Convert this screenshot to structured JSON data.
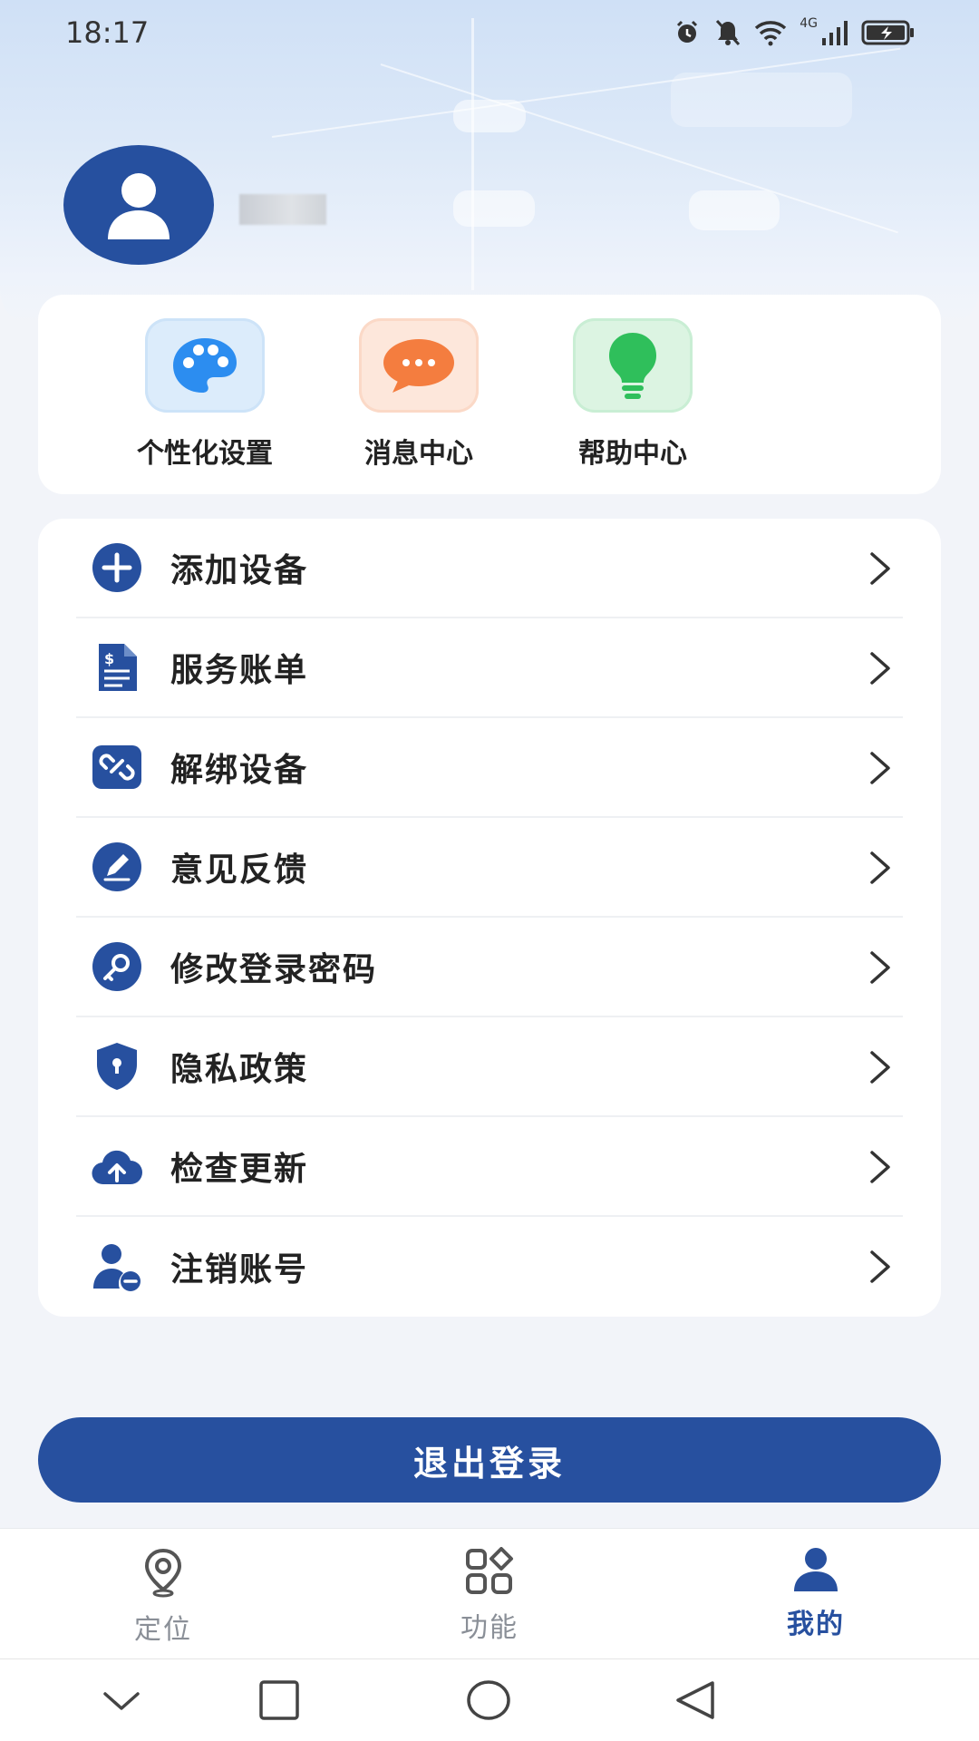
{
  "status_bar": {
    "time": "18:17",
    "network": "4G"
  },
  "profile": {
    "username": ""
  },
  "quick_actions": [
    {
      "label": "个性化设置",
      "icon": "palette-icon",
      "bg": "#dcecfb",
      "color": "#2c8df0"
    },
    {
      "label": "消息中心",
      "icon": "chat-bubble-icon",
      "bg": "#fde7db",
      "color": "#f47d3f"
    },
    {
      "label": "帮助中心",
      "icon": "lightbulb-icon",
      "bg": "#dcf4e2",
      "color": "#2fbf5b"
    }
  ],
  "menu": [
    {
      "label": "添加设备",
      "icon": "add-circle-icon"
    },
    {
      "label": "服务账单",
      "icon": "bill-icon"
    },
    {
      "label": "解绑设备",
      "icon": "unlink-icon"
    },
    {
      "label": "意见反馈",
      "icon": "edit-feedback-icon"
    },
    {
      "label": "修改登录密码",
      "icon": "key-icon"
    },
    {
      "label": "隐私政策",
      "icon": "shield-icon"
    },
    {
      "label": "检查更新",
      "icon": "cloud-upload-icon"
    },
    {
      "label": "注销账号",
      "icon": "user-remove-icon"
    }
  ],
  "logout_label": "退出登录",
  "tabs": [
    {
      "label": "定位",
      "icon": "location-pin-icon",
      "active": false
    },
    {
      "label": "功能",
      "icon": "grid-apps-icon",
      "active": false
    },
    {
      "label": "我的",
      "icon": "person-icon",
      "active": true
    }
  ],
  "colors": {
    "primary": "#27509f",
    "background": "#f2f4f9",
    "inactive_tab": "#8a8f97"
  }
}
